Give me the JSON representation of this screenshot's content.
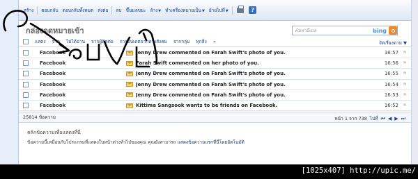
{
  "toolbar": {
    "items": [
      "สร้าง",
      "ตอบกลับ",
      "ตอบกลับทั้งหมด",
      "ส่งต่อ",
      "ลบ",
      "ขึ้นมลขยะ",
      "ล้าง",
      "ทำเครื่องหมายเป็น",
      "ย้ายไปที่"
    ],
    "with_arrow": [
      6,
      7,
      8
    ],
    "icons": [
      "printer-icon",
      "help-icon"
    ]
  },
  "header": {
    "title": "กล่องจดหมายเข้า",
    "search_placeholder": "ค้นหาอีเมล",
    "search_brand": "bing"
  },
  "filters": {
    "items": [
      "แสดง",
      "จาก",
      "ไม่ได้อ่าน",
      "จากผู้ติดต่อ",
      "การอัปเดตจากทางสังคม",
      "จากกลุ่ม",
      "ทุกสิ่ง",
      "«"
    ],
    "sort_label": "จัดเรียงตาม"
  },
  "messages": [
    {
      "sender": "Facebook",
      "subject": "Jenny Drew commented on Farah Swift's photo of you.",
      "time": "16:57"
    },
    {
      "sender": "Facebook",
      "subject": "Farah Swift commented on her photo of you.",
      "time": "16:56"
    },
    {
      "sender": "Facebook",
      "subject": "Jenny Drew commented on Farah Swift's photo of you.",
      "time": "16:55"
    },
    {
      "sender": "Facebook",
      "subject": "Jenny Drew commented on Farah Swift's photo of you.",
      "time": "16:54"
    },
    {
      "sender": "Facebook",
      "subject": "Jenny Drew commented on Farah Swift's photo of you.",
      "time": "16:53"
    },
    {
      "sender": "Facebook",
      "subject": "Kittima Sangsook wants to be friends on Facebook.",
      "time": "16:52"
    }
  ],
  "status": {
    "count": "25814 ข้อความ",
    "page_label": "หน้า 1 จาก 738",
    "next_label": "ไปที่"
  },
  "preview": {
    "hint": "คลิกข้อความเพื่อแสดงที่นี่",
    "note": "ข้อความนี้เหมือนกับโปรแกรมที่แสดงในหน้าต่างทั่วไปของคุณ คุณยังสามารถ",
    "note_link": "แสดงข้อความแรกที่นี่โดยอัตโนมัติ"
  },
  "caption": "[1025x407] http://upic.me/",
  "colors": {
    "link": "#15428b",
    "toolbar_bg": "#dde7f4",
    "border": "#b6c7de"
  }
}
